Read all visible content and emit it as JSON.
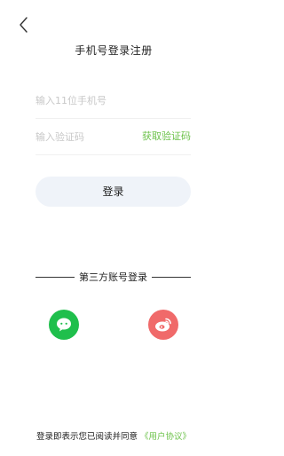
{
  "header": {
    "back_icon": "chevron-left-icon",
    "title": "手机号登录注册"
  },
  "form": {
    "phone_placeholder": "输入11位手机号",
    "phone_value": "",
    "code_placeholder": "输入验证码",
    "code_value": "",
    "get_code_label": "获取验证码",
    "login_label": "登录"
  },
  "third_party": {
    "label": "第三方账号登录",
    "providers": [
      {
        "name": "wechat",
        "icon": "wechat-icon",
        "color": "#1fbf4c"
      },
      {
        "name": "weibo",
        "icon": "weibo-icon",
        "color": "#f06a6a"
      }
    ]
  },
  "agreement": {
    "prefix": "登录即表示您已阅读并同意",
    "link_label": "《用户协议》"
  },
  "colors": {
    "accent": "#6cc24a",
    "button_bg": "#eff3f9",
    "placeholder": "#c8c8c8"
  }
}
